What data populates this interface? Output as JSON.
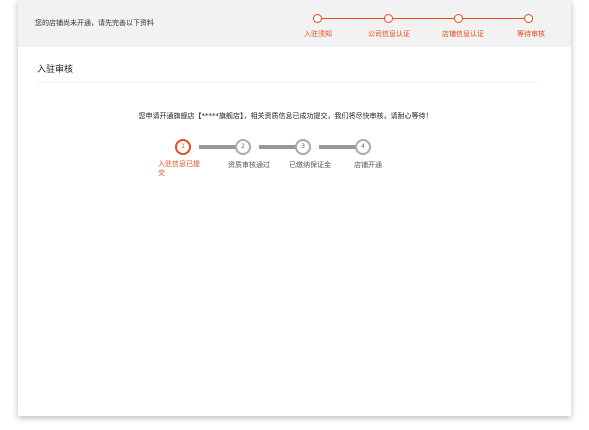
{
  "header": {
    "notice": "您的店铺尚未开通，请先完善以下资料",
    "steps": [
      {
        "label": "入驻须知"
      },
      {
        "label": "公司信息认证"
      },
      {
        "label": "店铺信息认证"
      },
      {
        "label": "等待审核"
      }
    ]
  },
  "main": {
    "title": "入驻审核",
    "message": "您申请开通旗舰店【*****旗舰店】，相关资质信息已成功提交，我们将尽快审核，请耐心等待！",
    "progress": [
      {
        "number": "1",
        "label": "入驻信息已提交",
        "active": true
      },
      {
        "number": "2",
        "label": "资质审核通过",
        "active": false
      },
      {
        "number": "3",
        "label": "已缴纳保证金",
        "active": false
      },
      {
        "number": "4",
        "label": "店铺开通",
        "active": false
      }
    ]
  },
  "colors": {
    "accent": "#e64a19",
    "header_bg": "#f2f2f2",
    "progress_line": "#999999"
  }
}
